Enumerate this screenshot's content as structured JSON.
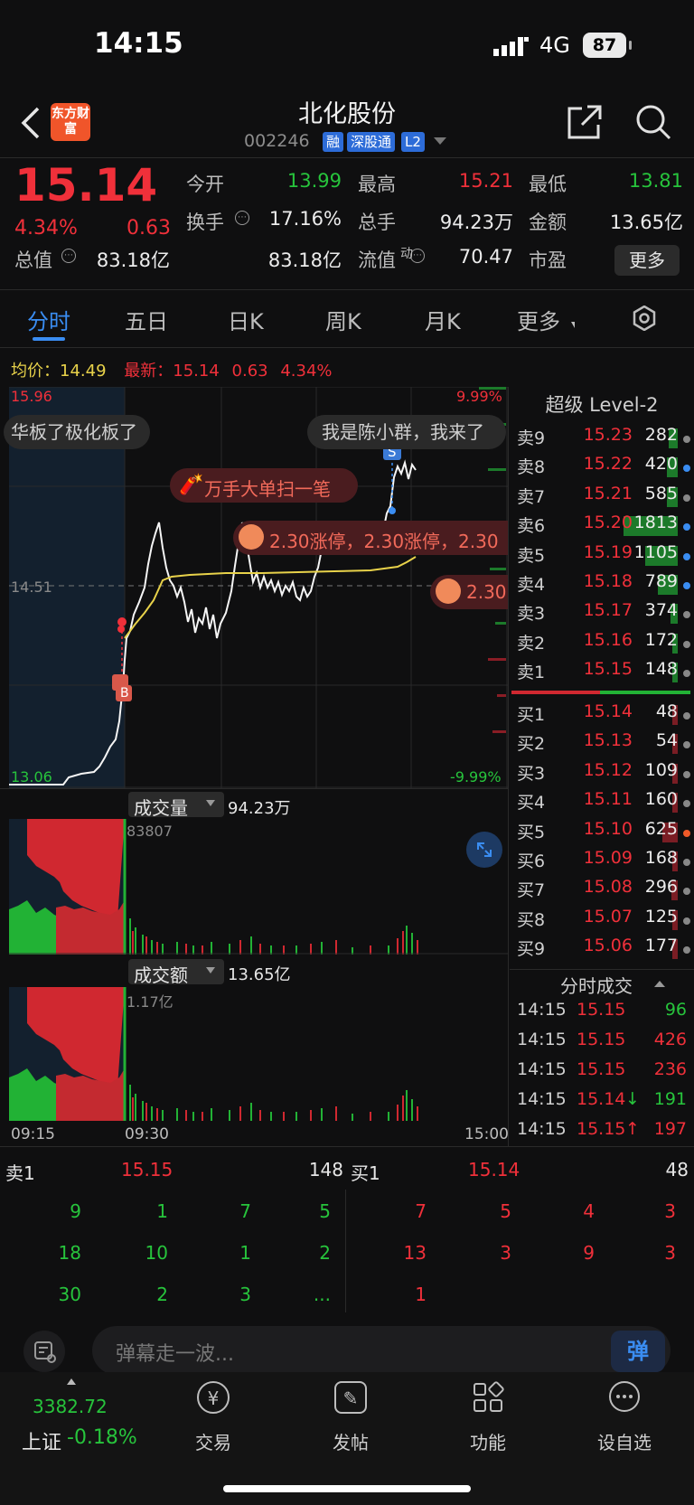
{
  "status": {
    "time": "14:15",
    "network": "4G",
    "battery": "87"
  },
  "header": {
    "logo_text": "东方财富",
    "title": "北化股份",
    "code": "002246",
    "tags": [
      "融",
      "深股通",
      "L2"
    ]
  },
  "quote": {
    "price": "15.14",
    "change_pct": "4.34%",
    "change": "0.63",
    "stats": [
      {
        "label": "今开",
        "value": "13.99",
        "color": "green"
      },
      {
        "label": "最高",
        "value": "15.21",
        "color": "red"
      },
      {
        "label": "最低",
        "value": "13.81",
        "color": "green"
      },
      {
        "label": "换手",
        "value": "17.16%",
        "color": "white"
      },
      {
        "label": "总手",
        "value": "94.23万",
        "color": "white"
      },
      {
        "label": "金额",
        "value": "13.65亿",
        "color": "white"
      },
      {
        "label": "总值",
        "value": "83.18亿",
        "color": "white"
      },
      {
        "label": "流值",
        "value": "83.18亿",
        "color": "white"
      },
      {
        "label": "市盈",
        "value": "70.47",
        "color": "white"
      }
    ],
    "pe_superscript": "动",
    "more_label": "更多"
  },
  "tabs": [
    "分时",
    "五日",
    "日K",
    "周K",
    "月K",
    "更多"
  ],
  "chart_info": {
    "avg_label": "均价：",
    "avg_value": "14.49",
    "latest_label": "最新：",
    "latest_value": "15.14",
    "latest_change": "0.63",
    "latest_pct": "4.34%",
    "y_high": "15.96",
    "y_mid": "14.51",
    "y_low": "13.06",
    "pct_high": "9.99%",
    "pct_low": "-9.99%",
    "danmaku": [
      "华板了极化板了",
      "我是陈小群，我来了",
      "万手大单扫一笔",
      "2.30涨停，2.30涨停，2.30",
      "2.30"
    ],
    "markers": {
      "buy": "B",
      "sell": "S"
    }
  },
  "volume": {
    "label": "成交量",
    "total": "94.23万",
    "peak": "83807"
  },
  "amount": {
    "label": "成交额",
    "total": "13.65亿",
    "peak": "1.17亿"
  },
  "time_axis": [
    "09:15",
    "09:30",
    "15:00"
  ],
  "level2_title": "超级 Level-2",
  "order_book": {
    "asks": [
      {
        "label": "卖9",
        "price": "15.23",
        "vol": "282",
        "bar": 0.08,
        "dot": "#888888"
      },
      {
        "label": "卖8",
        "price": "15.22",
        "vol": "420",
        "bar": 0.1,
        "dot": "#3a8df2"
      },
      {
        "label": "卖7",
        "price": "15.21",
        "vol": "585",
        "bar": 0.1,
        "dot": "#888888"
      },
      {
        "label": "卖6",
        "price": "15.20",
        "vol": "1813",
        "bar": 0.5,
        "dot": "#3a8df2"
      },
      {
        "label": "卖5",
        "price": "15.19",
        "vol": "1105",
        "bar": 0.3,
        "dot": "#3a8df2"
      },
      {
        "label": "卖4",
        "price": "15.18",
        "vol": "789",
        "bar": 0.18,
        "dot": "#3a8df2"
      },
      {
        "label": "卖3",
        "price": "15.17",
        "vol": "374",
        "bar": 0.07,
        "dot": "#888888"
      },
      {
        "label": "卖2",
        "price": "15.16",
        "vol": "172",
        "bar": 0.04,
        "dot": "#888888"
      },
      {
        "label": "卖1",
        "price": "15.15",
        "vol": "148",
        "bar": 0.03,
        "dot": "#888888"
      }
    ],
    "bids": [
      {
        "label": "买1",
        "price": "15.14",
        "vol": "48",
        "bar": 0.02,
        "dot": "#888888"
      },
      {
        "label": "买2",
        "price": "15.13",
        "vol": "54",
        "bar": 0.02,
        "dot": "#888888"
      },
      {
        "label": "买3",
        "price": "15.12",
        "vol": "109",
        "bar": 0.03,
        "dot": "#888888"
      },
      {
        "label": "买4",
        "price": "15.11",
        "vol": "160",
        "bar": 0.03,
        "dot": "#888888"
      },
      {
        "label": "买5",
        "price": "15.10",
        "vol": "625",
        "bar": 0.14,
        "dot": "#f05a28"
      },
      {
        "label": "买6",
        "price": "15.09",
        "vol": "168",
        "bar": 0.03,
        "dot": "#888888"
      },
      {
        "label": "买7",
        "price": "15.08",
        "vol": "296",
        "bar": 0.06,
        "dot": "#888888"
      },
      {
        "label": "买8",
        "price": "15.07",
        "vol": "125",
        "bar": 0.03,
        "dot": "#888888"
      },
      {
        "label": "买9",
        "price": "15.06",
        "vol": "177",
        "bar": 0.04,
        "dot": "#888888"
      }
    ]
  },
  "trades_title": "分时成交",
  "trades": [
    {
      "time": "14:15",
      "price": "15.15",
      "vol": "96",
      "dir": "",
      "volcolor": "green"
    },
    {
      "time": "14:15",
      "price": "15.15",
      "vol": "426",
      "dir": "",
      "volcolor": "red"
    },
    {
      "time": "14:15",
      "price": "15.15",
      "vol": "236",
      "dir": "",
      "volcolor": "red"
    },
    {
      "time": "14:15",
      "price": "15.14",
      "vol": "191",
      "dir": "↓",
      "volcolor": "green"
    },
    {
      "time": "14:15",
      "price": "15.15",
      "vol": "197",
      "dir": "↑",
      "volcolor": "red"
    }
  ],
  "queue": {
    "sell_label": "卖1",
    "sell_price": "15.15",
    "sell_vol": "148",
    "buy_label": "买1",
    "buy_price": "15.14",
    "buy_vol": "48",
    "sell_rows": [
      [
        "9",
        "1",
        "7",
        "5"
      ],
      [
        "18",
        "10",
        "1",
        "2"
      ],
      [
        "30",
        "2",
        "3",
        "..."
      ]
    ],
    "buy_rows": [
      [
        "7",
        "5",
        "4",
        "3"
      ],
      [
        "13",
        "3",
        "9",
        "3"
      ],
      [
        "1",
        "",
        "",
        ""
      ]
    ]
  },
  "danmu_placeholder": "弹幕走一波...",
  "danmu_button": "弹",
  "bottom_nav": {
    "index_value": "3382.72",
    "index_name": "上证",
    "index_change": "-0.18%",
    "items": [
      "交易",
      "发帖",
      "功能",
      "设自选"
    ]
  },
  "colors": {
    "up": "#f0303a",
    "down": "#27c43c",
    "accent": "#3a8df2",
    "avg_line": "#e8d24a"
  }
}
